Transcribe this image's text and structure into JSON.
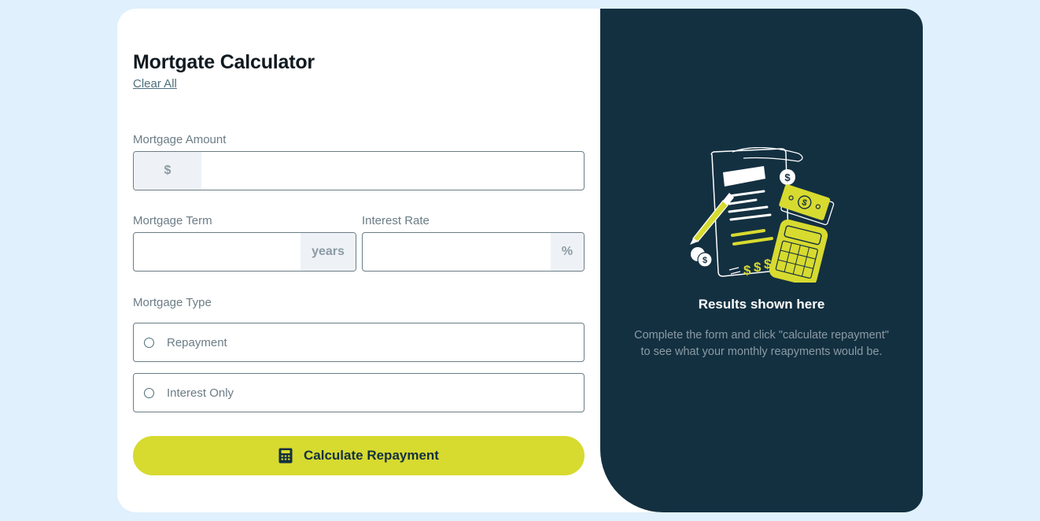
{
  "form": {
    "title": "Mortgate Calculator",
    "clear_label": "Clear All",
    "amount": {
      "label": "Mortgage Amount",
      "unit": "$",
      "value": ""
    },
    "term": {
      "label": "Mortgage Term",
      "unit": "years",
      "value": ""
    },
    "rate": {
      "label": "Interest Rate",
      "unit": "%",
      "value": ""
    },
    "type": {
      "label": "Mortgage Type",
      "options": [
        {
          "label": "Repayment",
          "checked": false
        },
        {
          "label": "Interest Only",
          "checked": false
        }
      ]
    },
    "submit_label": "Calculate Repayment"
  },
  "results": {
    "title": "Results shown here",
    "description": "Complete the form and click \"calculate repayment\" to see what your monthly reapyments would be."
  },
  "colors": {
    "accent": "#d7da2f",
    "dark_panel": "#133041",
    "page_bg": "#e0f0fc"
  },
  "icons": [
    "calculator-icon",
    "empty-results-illustration"
  ]
}
